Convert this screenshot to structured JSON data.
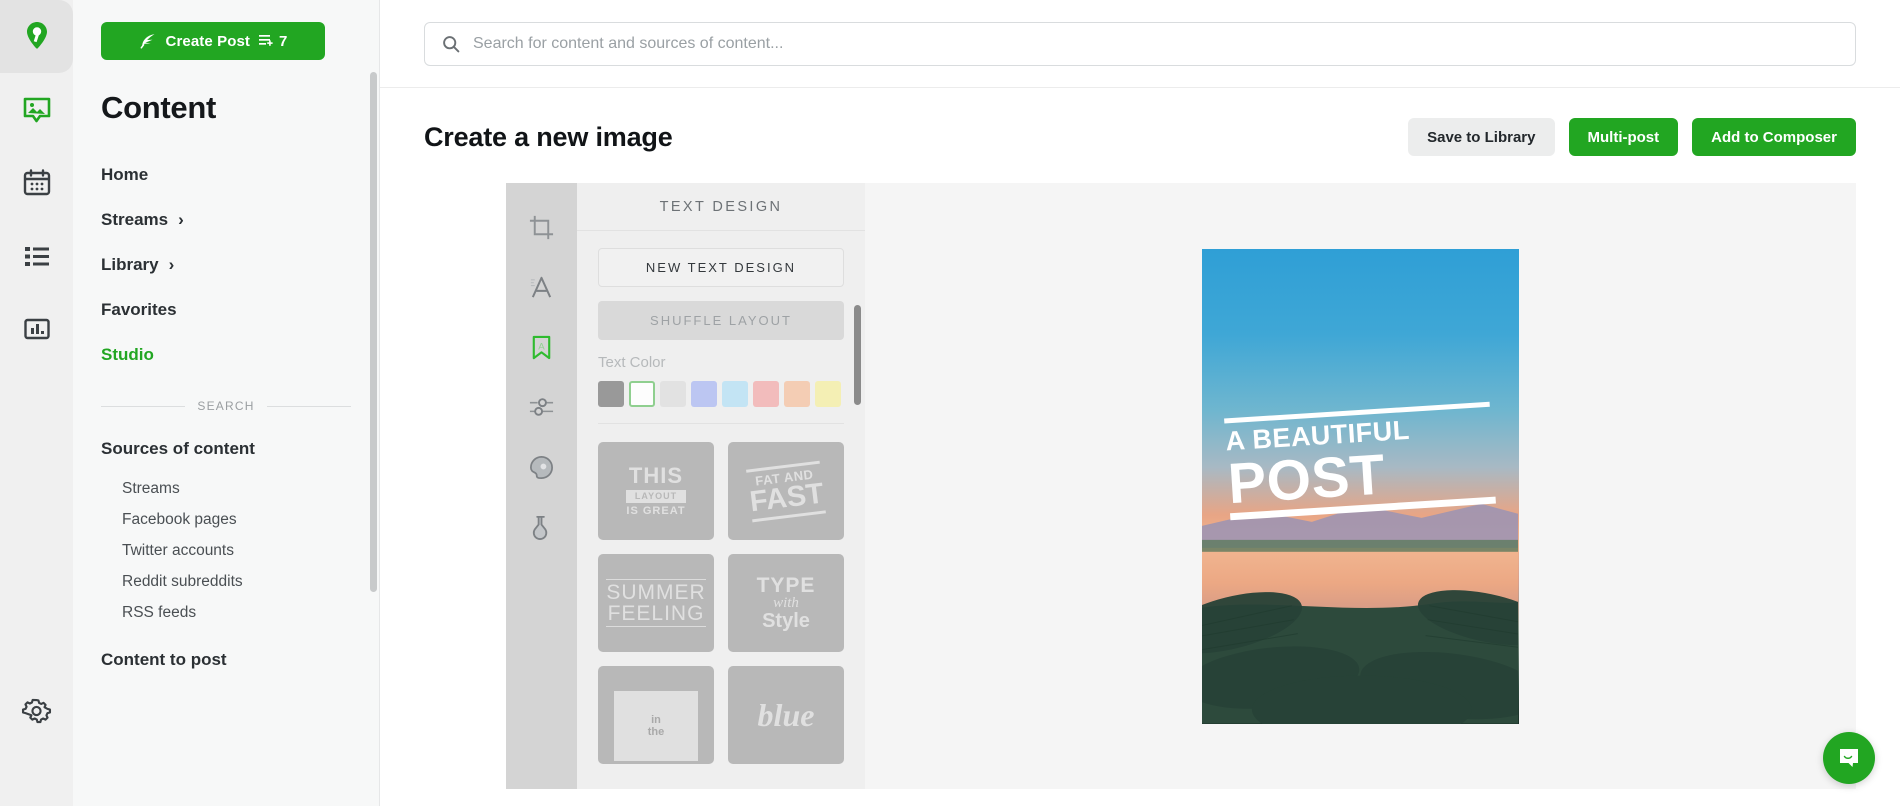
{
  "rail": {
    "items": [
      {
        "name": "logo-pin-icon",
        "label": "Logo"
      },
      {
        "name": "content-image-icon",
        "label": "Content"
      },
      {
        "name": "calendar-icon",
        "label": "Calendar"
      },
      {
        "name": "list-icon",
        "label": "Queue"
      },
      {
        "name": "analytics-bar-icon",
        "label": "Analytics"
      },
      {
        "name": "gear-icon",
        "label": "Settings"
      }
    ]
  },
  "sidebar": {
    "create_post": {
      "label": "Create Post",
      "count": "7",
      "icon": "feather-icon",
      "color": "#22a622"
    },
    "title": "Content",
    "nav": [
      {
        "label": "Home",
        "chevron": "",
        "active": false
      },
      {
        "label": "Streams",
        "chevron": "›",
        "active": false
      },
      {
        "label": "Library",
        "chevron": "›",
        "active": false
      },
      {
        "label": "Favorites",
        "chevron": "",
        "active": false
      },
      {
        "label": "Studio",
        "chevron": "",
        "active": true
      }
    ],
    "divider_label": "SEARCH",
    "sections": [
      {
        "heading": "Sources of content",
        "items": [
          "Streams",
          "Facebook pages",
          "Twitter accounts",
          "Reddit subreddits",
          "RSS feeds"
        ]
      },
      {
        "heading": "Content to post",
        "items": []
      }
    ]
  },
  "search": {
    "placeholder": "Search for content and sources of content...",
    "value": "",
    "icon": "search-icon"
  },
  "header": {
    "title": "Create a new image",
    "actions": [
      {
        "label": "Save to Library",
        "style": "grey",
        "name": "save-to-library-button"
      },
      {
        "label": "Multi-post",
        "style": "green",
        "name": "multi-post-button"
      },
      {
        "label": "Add to Composer",
        "style": "green",
        "name": "add-to-composer-button"
      }
    ]
  },
  "editor": {
    "tools": [
      {
        "name": "crop-icon",
        "label": "Crop",
        "active": false
      },
      {
        "name": "font-icon",
        "label": "Font",
        "active": false
      },
      {
        "name": "text-design-bookmark-icon",
        "label": "Text Design",
        "active": true
      },
      {
        "name": "adjustments-icon",
        "label": "Adjustments",
        "active": false
      },
      {
        "name": "sticker-icon",
        "label": "Sticker",
        "active": false
      },
      {
        "name": "filter-flask-icon",
        "label": "Filters",
        "active": false
      }
    ],
    "panel": {
      "title": "TEXT DESIGN",
      "new_design_label": "NEW TEXT DESIGN",
      "shuffle_label": "SHUFFLE LAYOUT",
      "text_color_label": "Text Color",
      "swatches": [
        {
          "hex": "#999999",
          "selected": false
        },
        {
          "hex": "#fdfdfd",
          "selected": true
        },
        {
          "hex": "#e2e2e2",
          "selected": false
        },
        {
          "hex": "#bcc6f2",
          "selected": false
        },
        {
          "hex": "#c3e4f4",
          "selected": false
        },
        {
          "hex": "#f2bcbc",
          "selected": false
        },
        {
          "hex": "#f4cdb4",
          "selected": false
        },
        {
          "hex": "#f4efb4",
          "selected": false
        }
      ],
      "designs": [
        {
          "lines": [
            "THIS",
            "LAYOUT",
            "IS GREAT"
          ],
          "style": "banner"
        },
        {
          "lines": [
            "FAT AND",
            "FAST"
          ],
          "style": "slant"
        },
        {
          "lines": [
            "SUMMER",
            "FEELING"
          ],
          "style": "condensed"
        },
        {
          "lines": [
            "TYPE",
            "with",
            "Style"
          ],
          "style": "mixed"
        },
        {
          "lines": [
            "in",
            "the"
          ],
          "style": "box"
        },
        {
          "lines": [
            "blue"
          ],
          "style": "script"
        }
      ]
    },
    "preview": {
      "text_line1": "A BEAUTIFUL",
      "text_line2": "POST",
      "alt": "Sunset lake with palm fronds"
    }
  },
  "chat": {
    "icon": "chat-bubble-icon",
    "color": "#22a622"
  }
}
